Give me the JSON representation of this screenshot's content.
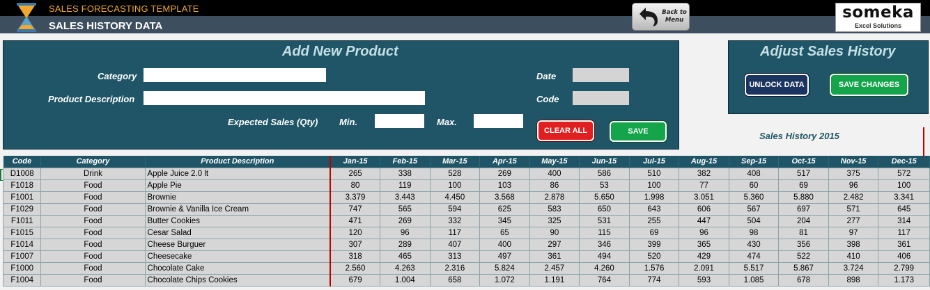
{
  "header": {
    "app_title": "SALES FORECASTING TEMPLATE",
    "page_title": "SALES HISTORY DATA",
    "back_line1": "Back to",
    "back_line2": "Menu",
    "logo_word": "someka",
    "logo_sub": "Excel Solutions"
  },
  "add_product": {
    "title": "Add New Product",
    "category_label": "Category",
    "category_value": "",
    "description_label": "Product Description",
    "description_value": "",
    "expected_label": "Expected Sales (Qty)",
    "min_label": "Min.",
    "min_value": "",
    "max_label": "Max.",
    "max_value": "",
    "date_label": "Date",
    "date_value": "",
    "code_label": "Code",
    "code_value": "",
    "clear_label": "CLEAR ALL",
    "save_label": "SAVE"
  },
  "adjust": {
    "title": "Adjust Sales History",
    "unlock_label": "UNLOCK DATA",
    "save_changes_label": "SAVE CHANGES"
  },
  "table": {
    "year_label": "Sales History 2015",
    "headers": [
      "Code",
      "Category",
      "Product Description",
      "Jan-15",
      "Feb-15",
      "Mar-15",
      "Apr-15",
      "May-15",
      "Jun-15",
      "Jul-15",
      "Aug-15",
      "Sep-15",
      "Oct-15",
      "Nov-15",
      "Dec-15"
    ],
    "rows": [
      [
        "D1008",
        "Drink",
        "Apple Juice 2.0 lt",
        "265",
        "338",
        "528",
        "269",
        "400",
        "586",
        "510",
        "382",
        "408",
        "517",
        "375",
        "572"
      ],
      [
        "F1018",
        "Food",
        "Apple Pie",
        "80",
        "119",
        "100",
        "103",
        "86",
        "53",
        "100",
        "77",
        "60",
        "69",
        "96",
        "100"
      ],
      [
        "F1001",
        "Food",
        "Brownie",
        "3.379",
        "3.443",
        "4.450",
        "3.568",
        "2.878",
        "5.650",
        "1.998",
        "3.051",
        "5.360",
        "5.880",
        "2.482",
        "3.341"
      ],
      [
        "F1029",
        "Food",
        "Brownie & Vanilla Ice Cream",
        "747",
        "565",
        "594",
        "625",
        "583",
        "650",
        "643",
        "606",
        "567",
        "697",
        "571",
        "645"
      ],
      [
        "F1011",
        "Food",
        "Butter Cookies",
        "471",
        "269",
        "332",
        "345",
        "325",
        "531",
        "255",
        "447",
        "504",
        "204",
        "277",
        "314"
      ],
      [
        "F1015",
        "Food",
        "Cesar Salad",
        "120",
        "96",
        "117",
        "65",
        "90",
        "115",
        "69",
        "96",
        "98",
        "81",
        "97",
        "117"
      ],
      [
        "F1014",
        "Food",
        "Cheese Burguer",
        "307",
        "289",
        "407",
        "400",
        "297",
        "346",
        "399",
        "365",
        "430",
        "356",
        "398",
        "361"
      ],
      [
        "F1007",
        "Food",
        "Cheesecake",
        "318",
        "465",
        "313",
        "497",
        "361",
        "494",
        "520",
        "429",
        "474",
        "522",
        "410",
        "406"
      ],
      [
        "F1000",
        "Food",
        "Chocolate Cake",
        "2.560",
        "4.263",
        "2.316",
        "5.824",
        "2.457",
        "4.260",
        "1.576",
        "2.091",
        "5.517",
        "5.867",
        "3.724",
        "2.799"
      ],
      [
        "F1004",
        "Food",
        "Chocolate Chips Cookies",
        "679",
        "1.004",
        "658",
        "1.072",
        "1.191",
        "764",
        "774",
        "593",
        "1.085",
        "678",
        "898",
        "1.173"
      ]
    ]
  },
  "colors": {
    "panel": "#1f5566",
    "header_black": "#000000",
    "header_slate": "#3d4f5f",
    "app_title": "#f0a830",
    "red": "#e02020",
    "green": "#14a54a",
    "navy": "#1c3560"
  }
}
